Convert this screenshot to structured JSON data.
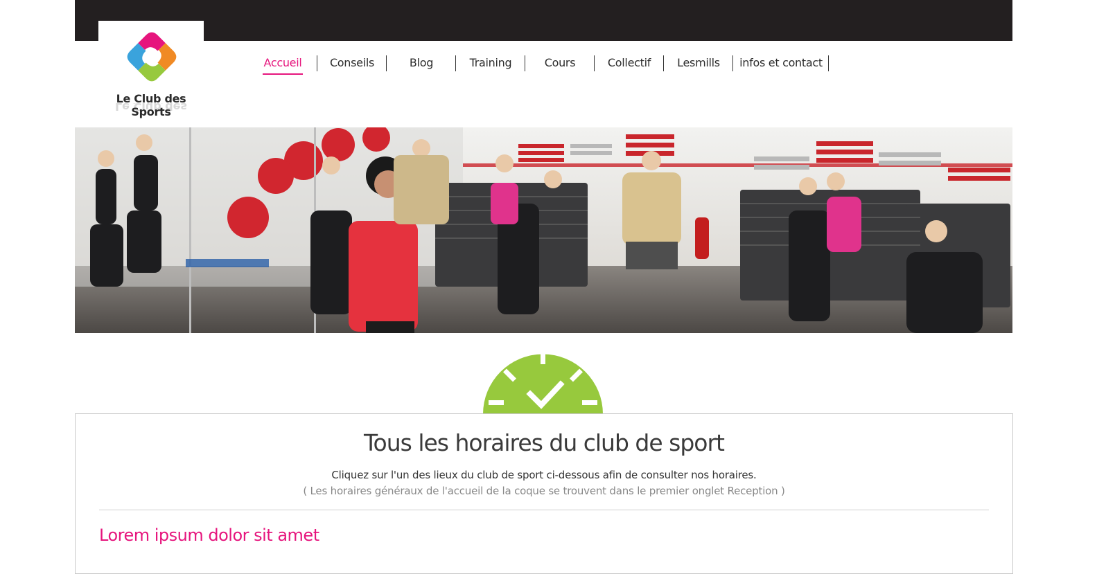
{
  "brand": {
    "name": "Le Club des Sports",
    "colors": {
      "pink": "#e6157d",
      "green": "#97c93d",
      "blue": "#3aa3dc",
      "orange": "#f08a24",
      "dark": "#231f20"
    }
  },
  "nav": {
    "items": [
      {
        "label": "Accueil",
        "active": true
      },
      {
        "label": "Conseils"
      },
      {
        "label": "Blog"
      },
      {
        "label": "Training"
      },
      {
        "label": "Cours"
      },
      {
        "label": "Collectif"
      },
      {
        "label": "Lesmills"
      },
      {
        "label": "infos et contact"
      }
    ]
  },
  "hero": {
    "icon": "fitness-class-photo"
  },
  "schedule": {
    "icon": "clock-check-icon",
    "title": "Tous les horaires du club de sport",
    "subtitle": "Cliquez sur l'un des lieux du club de sport ci-dessous afin de consulter nos horaires.",
    "note": "( Les horaires généraux de l'accueil de la coque se trouvent dans le premier onglet Reception )",
    "section_heading": "Lorem ipsum dolor sit amet"
  }
}
